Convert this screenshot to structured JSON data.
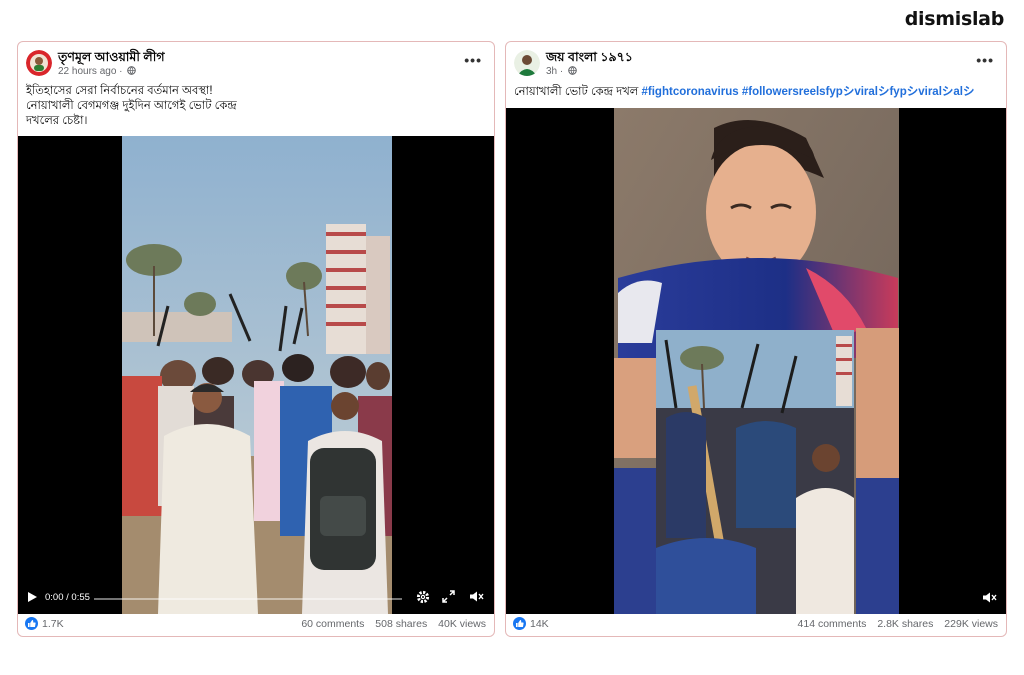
{
  "brand": "dismislab",
  "posts": [
    {
      "page_name": "তৃণমূল আওয়ামী লীগ",
      "time": "22 hours ago ·",
      "caption_lines": [
        "ইতিহাসের সেরা নির্বাচনের বর্তমান অবস্থা!",
        "নোয়াখালী বেগমগঞ্জ দুইদিন আগেই ভোট কেন্দ্র",
        " দখলের চেষ্টা।"
      ],
      "video_time": "0:00 / 0:55",
      "reactions": "1.7K",
      "comments": "60 comments",
      "shares": "508 shares",
      "views": "40K views"
    },
    {
      "page_name": "জয় বাংলা ১৯৭১",
      "time": "3h ·",
      "caption_text": "নোয়াখালী ভোট কেন্দ্র দখল ",
      "caption_tags": "#fightcoronavirus #followersreelsfypシviralシfypシviralシalシ",
      "reactions": "14K",
      "comments": "414 comments",
      "shares": "2.8K shares",
      "views": "229K views"
    }
  ],
  "colors": {
    "card_border": "#e4b8b8",
    "hashtag": "#216fdb",
    "like": "#1877f2",
    "meta": "#65676b"
  },
  "icons": [
    "globe-icon",
    "more-options-icon",
    "play-icon",
    "settings-gear-icon",
    "fullscreen-icon",
    "volume-muted-icon",
    "like-icon"
  ]
}
